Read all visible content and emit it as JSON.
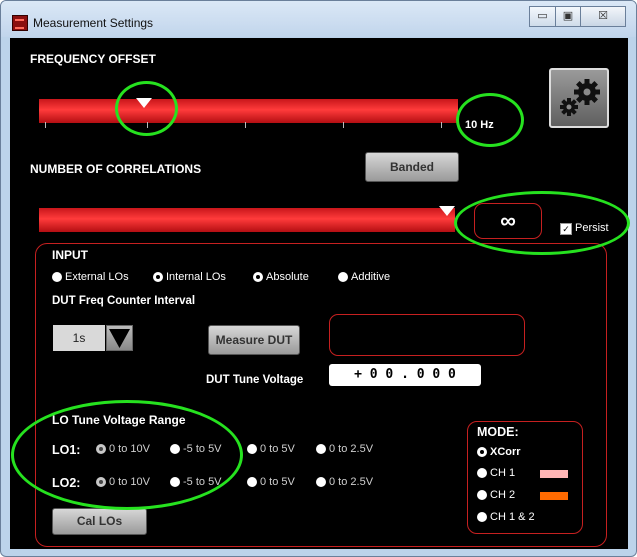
{
  "window": {
    "title": "Measurement Settings",
    "controls": {
      "minimize": "▭",
      "maximize": "▣",
      "close": "☒"
    }
  },
  "frequency_offset": {
    "label": "FREQUENCY OFFSET",
    "value_display": "10 Hz",
    "slider_level": 0.25
  },
  "settings": {
    "icon": "gear-icon"
  },
  "correlations": {
    "label": "NUMBER OF CORRELATIONS",
    "banded_label": "Banded",
    "value_display": "∞",
    "slider_level": 0.98,
    "persist_label": "Persist",
    "persist_checked": true
  },
  "input": {
    "title": "INPUT",
    "options": [
      {
        "label": "External LOs",
        "selected": false
      },
      {
        "label": "Internal LOs",
        "selected": true
      },
      {
        "label": "Absolute",
        "selected": true
      },
      {
        "label": "Additive",
        "selected": false
      }
    ],
    "dut_counter_label": "DUT Freq Counter Interval",
    "interval_value": "1s",
    "measure_dut_label": "Measure DUT",
    "dut_readout": "",
    "dut_tune_label": "DUT Tune Voltage",
    "dut_tune_value": "+ 0 0 . 0 0 0"
  },
  "lo_range": {
    "title": "LO Tune Voltage Range",
    "lo1": {
      "label": "LO1:",
      "options": [
        "0 to 10V",
        "-5 to 5V",
        "0 to 5V",
        "0 to 2.5V"
      ],
      "selected": 0
    },
    "lo2": {
      "label": "LO2:",
      "options": [
        "0 to 10V",
        "-5 to 5V",
        "0 to 5V",
        "0 to 2.5V"
      ],
      "selected": 0
    },
    "cal_label": "Cal LOs"
  },
  "mode": {
    "title": "MODE:",
    "options": [
      {
        "label": "XCorr",
        "selected": true,
        "swatch": ""
      },
      {
        "label": "CH 1",
        "selected": false,
        "swatch": "#ffb6b6"
      },
      {
        "label": "CH 2",
        "selected": false,
        "swatch": "#ff6a00"
      },
      {
        "label": "CH 1 & 2",
        "selected": false,
        "swatch": ""
      }
    ]
  },
  "colors": {
    "accent_red": "#e8262b",
    "highlight_green": "#26e21f"
  }
}
